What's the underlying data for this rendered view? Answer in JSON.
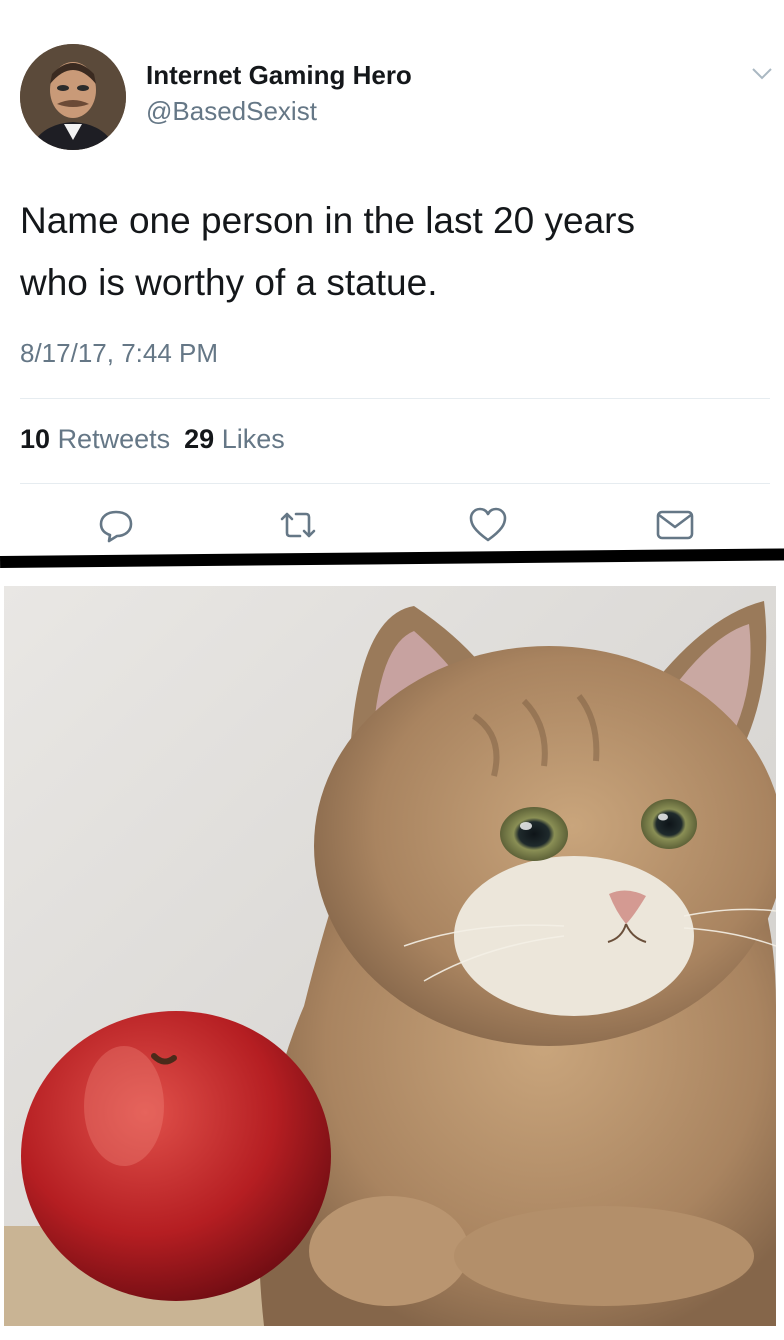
{
  "tweet": {
    "author_name": "Internet Gaming Hero",
    "author_handle": "@BasedSexist",
    "text_line1": "Name one person in the last 20 years",
    "text_line2": "who is worthy of a statue.",
    "timestamp": "8/17/17, 7:44 PM",
    "retweets_count": "10",
    "retweets_label": "Retweets",
    "likes_count": "29",
    "likes_label": "Likes"
  },
  "icons": {
    "menu": "chevron-down-icon",
    "reply": "reply-icon",
    "retweet": "retweet-icon",
    "like": "heart-icon",
    "message": "envelope-icon"
  },
  "colors": {
    "text_primary": "#14171a",
    "text_secondary": "#657786",
    "icon": "#657786",
    "divider": "#e6ecf0",
    "separator": "#000000"
  }
}
